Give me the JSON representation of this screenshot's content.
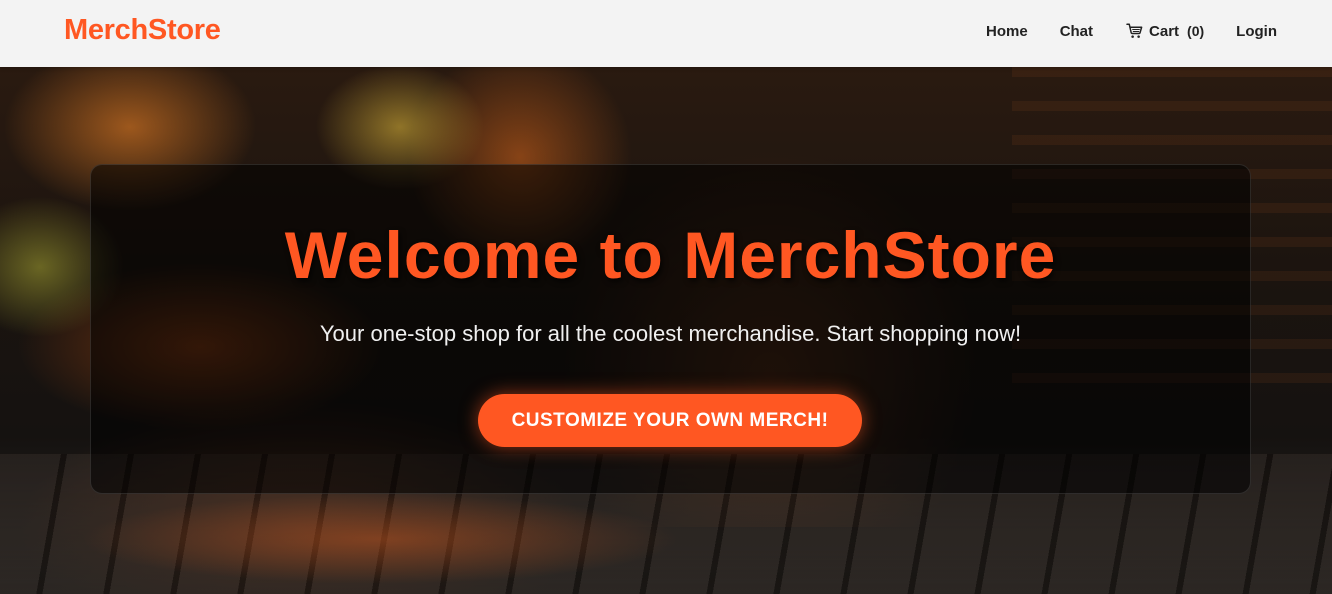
{
  "navbar": {
    "brand": "MerchStore",
    "links": {
      "home": "Home",
      "chat": "Chat",
      "cart_label": "Cart",
      "cart_count": "(0)",
      "login": "Login"
    }
  },
  "hero": {
    "title": "Welcome to MerchStore",
    "subtitle": "Your one-stop shop for all the coolest merchandise. Start shopping now!",
    "cta_label": "CUSTOMIZE YOUR OWN MERCH!"
  },
  "colors": {
    "accent": "#ff5722",
    "navbar_bg": "#f3f3f3",
    "card_bg": "rgba(0,0,0,0.55)"
  },
  "icons": {
    "cart": "shopping-cart-icon"
  }
}
